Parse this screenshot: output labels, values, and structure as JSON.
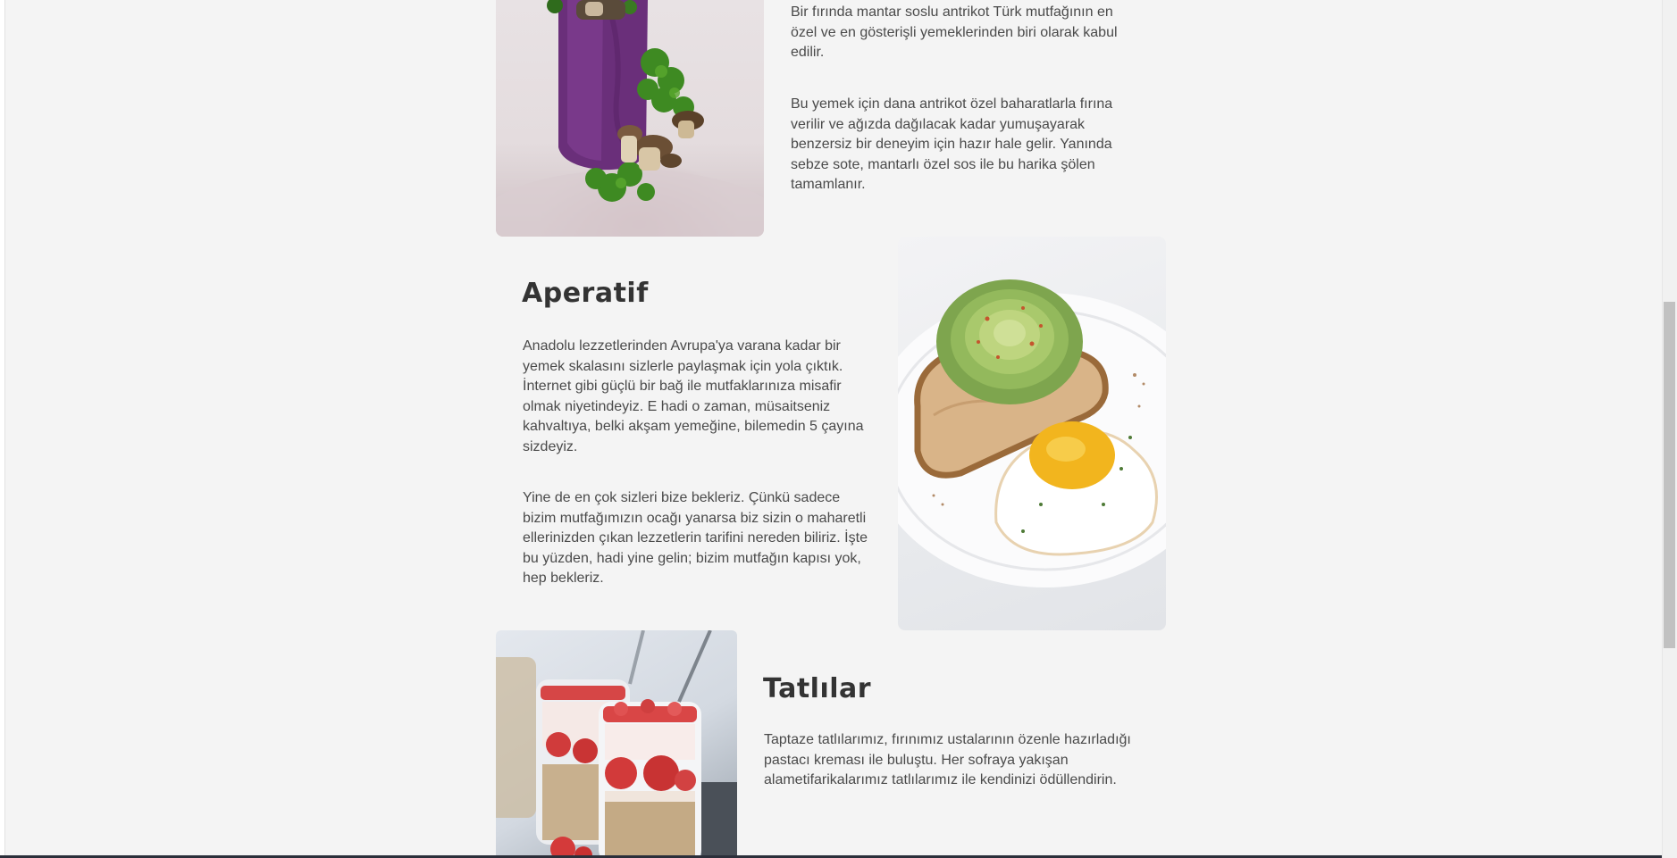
{
  "sections": {
    "antrikot": {
      "para1": "Bir fırında mantar soslu antrikot Türk mutfağının en özel ve en gösterişli yemeklerinden biri olarak kabul edilir.",
      "para2": "Bu yemek için dana antrikot özel baharatlarla fırına verilir ve ağızda dağılacak kadar yumuşayarak benzersiz bir deneyim için hazır hale gelir. Yanında sebze sote, mantarlı özel sos ile bu harika şölen tamamlanır."
    },
    "aperatif": {
      "title": "Aperatif",
      "para1": "Anadolu lezzetlerinden Avrupa'ya varana kadar bir yemek skalasını sizlerle paylaşmak için yola çıktık. İnternet gibi güçlü bir bağ ile mutfaklarınıza misafir olmak niyetindeyiz. E hadi o zaman, müsaitseniz kahvaltıya, belki akşam yemeğine, bilemedin 5 çayına sizdeyiz.",
      "para2": "Yine de en çok sizleri bize bekleriz. Çünkü sadece bizim mutfağımızın ocağı yanarsa biz sizin o maharetli ellerinizden çıkan lezzetlerin tarifini nereden biliriz. İşte bu yüzden, hadi yine gelin; bizim mutfağın kapısı yok, hep bekleriz."
    },
    "tatlilar": {
      "title": "Tatlılar",
      "para1": "Taptaze tatlılarımız, fırınımız ustalarının özenle hazırladığı pastacı kreması ile buluştu. Her sofraya yakışan alametifarikalarımız tatlılarımız ile kendinizi ödüllendirin."
    }
  },
  "colors": {
    "background": "#f4f4f4",
    "text": "#4a4a4a",
    "heading": "#333333"
  }
}
